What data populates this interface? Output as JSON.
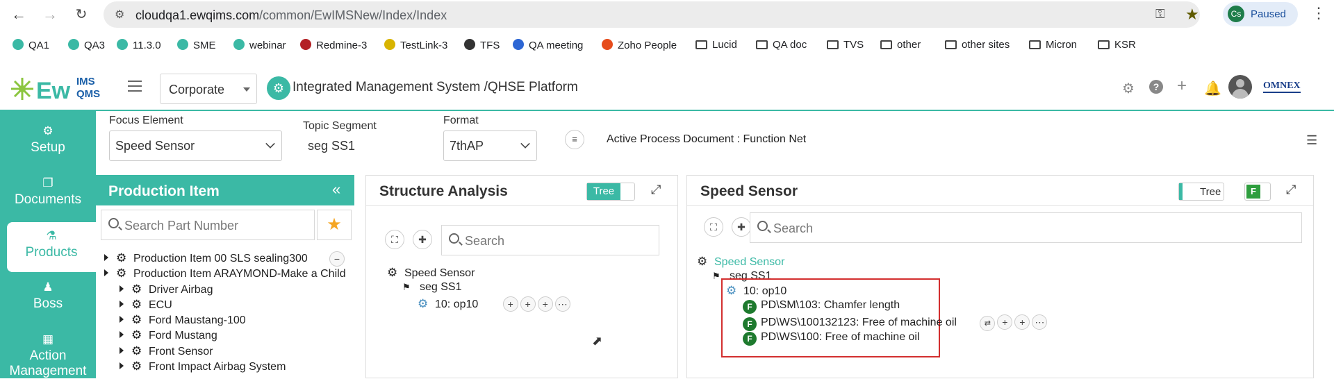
{
  "browser": {
    "url_host": "cloudqa1.ewqims.com",
    "url_path": "/common/EwIMSNew/Index/Index",
    "profile_initials": "Cs",
    "profile_status": "Paused",
    "bookmarks": [
      {
        "label": "QA1",
        "icon": "ewqims-icon"
      },
      {
        "label": "QA3",
        "icon": "ewqims-icon"
      },
      {
        "label": "11.3.0",
        "icon": "ewqims-icon"
      },
      {
        "label": "SME",
        "icon": "ewqims-icon"
      },
      {
        "label": "webinar",
        "icon": "ewqims-icon"
      },
      {
        "label": "Redmine-3",
        "icon": "redmine-icon"
      },
      {
        "label": "TestLink-3",
        "icon": "testlink-icon"
      },
      {
        "label": "TFS",
        "icon": "globe-icon"
      },
      {
        "label": "QA meeting",
        "icon": "zoom-icon"
      },
      {
        "label": "Zoho People",
        "icon": "zoho-icon"
      },
      {
        "label": "Lucid",
        "icon": "folder-icon"
      },
      {
        "label": "QA doc",
        "icon": "folder-icon"
      },
      {
        "label": "TVS",
        "icon": "folder-icon"
      },
      {
        "label": "other",
        "icon": "folder-icon"
      },
      {
        "label": "other sites",
        "icon": "folder-icon"
      },
      {
        "label": "Micron",
        "icon": "folder-icon"
      },
      {
        "label": "KSR",
        "icon": "folder-icon"
      }
    ]
  },
  "header": {
    "logo_text": "Ew",
    "logo_sup": "IMS",
    "logo_sub": "QMS",
    "org_select": "Corporate",
    "platform_title": "Integrated Management System /QHSE Platform",
    "brand_text": "OMNEX",
    "accent_color": "#3bb9a5"
  },
  "sidebar": {
    "items": [
      {
        "label": "Setup",
        "icon": "gears-icon"
      },
      {
        "label": "Documents",
        "icon": "documents-icon"
      },
      {
        "label": "Products",
        "icon": "products-icon",
        "active": true
      },
      {
        "label": "Boss",
        "icon": "user-icon"
      },
      {
        "label": "Action Management",
        "icon": "building-icon"
      }
    ]
  },
  "focus_bar": {
    "focus_label": "Focus Element",
    "focus_value": "Speed Sensor",
    "topic_label": "Topic Segment",
    "topic_value": "seg SS1",
    "format_label": "Format",
    "format_value": "7thAP",
    "active_doc": "Active Process Document : Function Net"
  },
  "production_panel": {
    "title": "Production Item",
    "search_placeholder": "Search Part Number",
    "items": [
      "Production Item 00 SLS sealing300",
      "Production Item ARAYMOND-Make a Child",
      "Driver Airbag",
      "ECU",
      "Ford Maustang-100",
      "Ford Mustang",
      "Front Sensor",
      "Front Impact Airbag System"
    ]
  },
  "structure_panel": {
    "title": "Structure Analysis",
    "toggle_label": "Tree",
    "search_placeholder": "Search",
    "tree": {
      "root": "Speed Sensor",
      "segment": "seg SS1",
      "op": "10: op10"
    }
  },
  "detail_panel": {
    "title": "Speed Sensor",
    "toggle_label": "Tree",
    "f_label": "F",
    "search_placeholder": "Search",
    "tree": {
      "root": "Speed Sensor",
      "segment": "seg SS1",
      "op": "10: op10",
      "functions": [
        {
          "badge": "F",
          "label": "PD\\SM\\103: Chamfer length"
        },
        {
          "badge": "F",
          "label": "PD\\WS\\100132123: Free of machine oil"
        },
        {
          "badge": "F",
          "label": "PD\\WS\\100: Free of machine oil"
        }
      ]
    }
  }
}
